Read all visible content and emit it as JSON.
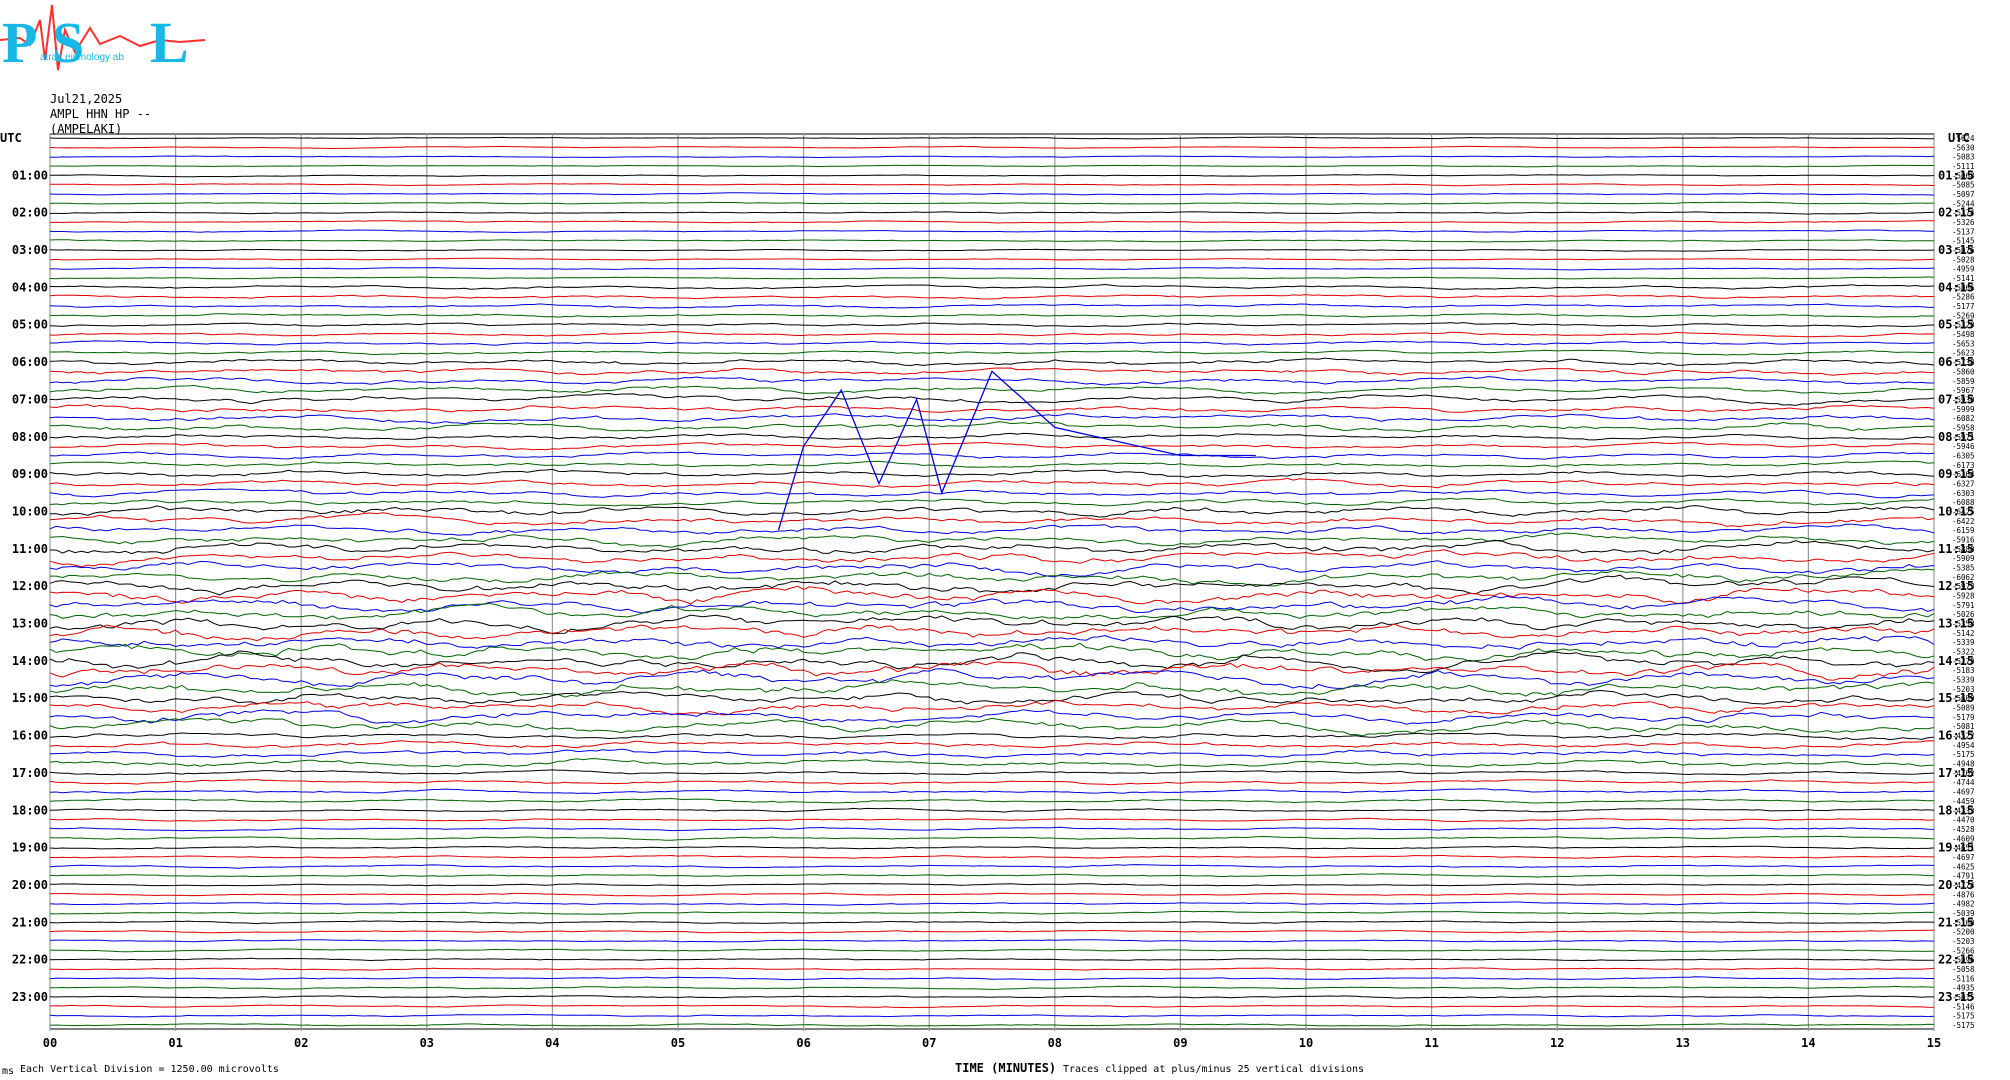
{
  "logo": {
    "letters": [
      "P",
      "S",
      "L"
    ],
    "small_words": [
      "atras",
      "eismology",
      "ab"
    ]
  },
  "header": {
    "date": "Jul21,2025",
    "station_line": "AMPL HHN HP --",
    "station_name": "(AMPELAKI)"
  },
  "footer": {
    "scale_note": "Each Vertical Division = 1250.00 microvolts",
    "clip_note": "Traces clipped at plus/minus 25 vertical divisions",
    "xlabel": "TIME (MINUTES)",
    "corner_mark": "ms"
  },
  "chart_data": {
    "type": "line",
    "title": "",
    "xlabel": "TIME (MINUTES)",
    "xlim": [
      0,
      15
    ],
    "x_ticks": [
      "00",
      "01",
      "02",
      "03",
      "04",
      "05",
      "06",
      "07",
      "08",
      "09",
      "10",
      "11",
      "12",
      "13",
      "14",
      "15"
    ],
    "left_axis_title": "UTC",
    "right_axis_title": "UTC",
    "left_hour_labels": [
      "01:00",
      "02:00",
      "03:00",
      "04:00",
      "05:00",
      "06:00",
      "07:00",
      "08:00",
      "09:00",
      "10:00",
      "11:00",
      "12:00",
      "13:00",
      "14:00",
      "15:00",
      "16:00",
      "17:00",
      "18:00",
      "19:00",
      "20:00",
      "21:00",
      "22:00",
      "23:00"
    ],
    "right_hour_labels": [
      "01:15",
      "02:15",
      "03:15",
      "04:15",
      "05:15",
      "06:15",
      "07:15",
      "08:15",
      "09:15",
      "10:15",
      "11:15",
      "12:15",
      "13:15",
      "14:15",
      "15:15",
      "16:15",
      "17:15",
      "18:15",
      "19:15",
      "20:15",
      "21:15",
      "22:15",
      "23:15"
    ],
    "trace_colors": [
      "#000000",
      "#e00000",
      "#0000e0",
      "#006400"
    ],
    "trace_count": 96,
    "trace_offsets": [
      "-5624",
      "-5630",
      "-5083",
      "-5111",
      "-5068",
      "-5085",
      "-5097",
      "-5244",
      "-5374",
      "-5326",
      "-5137",
      "-5145",
      "-5076",
      "-5028",
      "-4959",
      "-5141",
      "-5066",
      "-5286",
      "-5177",
      "-5269",
      "-5320",
      "-5498",
      "-5653",
      "-5623",
      "-5738",
      "-5860",
      "-5859",
      "-5967",
      "-5930",
      "-5999",
      "-6082",
      "-5958",
      "-5971",
      "-5946",
      "-6305",
      "-6173",
      "-6364",
      "-6327",
      "-6303",
      "-6088",
      "-6425",
      "-6422",
      "-6159",
      "-5916",
      "-5880",
      "-5909",
      "-5385",
      "-6062",
      "-5973",
      "-5928",
      "-5791",
      "-5026",
      "-5358",
      "-5142",
      "-5339",
      "-5322",
      "-5279",
      "-5183",
      "-5339",
      "-5203",
      "-5609",
      "-5089",
      "-5179",
      "-5081",
      "-4522",
      "-4954",
      "-5175",
      "-4948",
      "-4762",
      "-4744",
      "-4697",
      "-4459",
      "-4333",
      "-4470",
      "-4528",
      "-4609",
      "-4651",
      "-4697",
      "-4625",
      "-4791",
      "-4774",
      "-4876",
      "-4982",
      "-5039",
      "-5160",
      "-5200",
      "-5203",
      "-5266",
      "-5096",
      "-5058",
      "-5116",
      "-4935",
      "-5015",
      "-5146",
      "-5175",
      "-5175"
    ],
    "noise_level_by_hour": [
      0.5,
      0.6,
      0.7,
      0.6,
      1.4,
      1.3,
      2.5,
      2.8,
      2.0,
      2.5,
      3.5,
      4.5,
      5.0,
      5.5,
      5.5,
      4.5,
      2.5,
      1.4,
      1.0,
      0.9,
      0.8,
      0.8,
      0.8,
      0.8
    ],
    "highlighted_event": {
      "trace_hour_start": "07:45",
      "x_minutes": [
        5.8,
        6.0,
        6.3,
        6.6,
        6.9,
        7.1,
        7.5,
        8.0,
        9.0,
        9.6
      ],
      "y_divisions": [
        -11,
        -2,
        4,
        -6,
        3,
        -7,
        6,
        0,
        -3,
        -3
      ],
      "color": "#0000e0"
    },
    "grid": true
  }
}
